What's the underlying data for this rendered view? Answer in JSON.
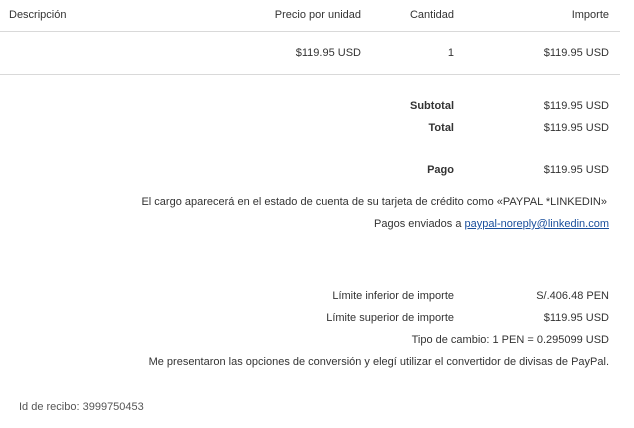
{
  "table": {
    "headers": {
      "description": "Descripción",
      "unit_price": "Precio por unidad",
      "quantity": "Cantidad",
      "amount": "Importe"
    },
    "rows": [
      {
        "description": "",
        "unit_price": "$119.95 USD",
        "quantity": "1",
        "amount": "$119.95 USD"
      }
    ]
  },
  "summary": {
    "subtotal_label": "Subtotal",
    "subtotal_value": "$119.95 USD",
    "total_label": "Total",
    "total_value": "$119.95 USD",
    "payment_label": "Pago",
    "payment_value": "$119.95 USD",
    "charge_note": "El cargo aparecerá en el estado de cuenta de su tarjeta de crédito como «PAYPAL *LINKEDIN»",
    "sent_to_label": "Pagos enviados a",
    "sent_to_email": "paypal-noreply@linkedin.com"
  },
  "conversion": {
    "lower_limit_label": "Límite inferior de importe",
    "lower_limit_value": "S/.406.48 PEN",
    "upper_limit_label": "Límite superior de importe",
    "upper_limit_value": "$119.95 USD",
    "exchange_rate": "Tipo de cambio: 1 PEN = 0.295099 USD",
    "conversion_note": "Me presentaron las opciones de conversión y elegí utilizar el convertidor de divisas de PayPal."
  },
  "receipt": {
    "id_text": "Id de recibo: 3999750453"
  }
}
